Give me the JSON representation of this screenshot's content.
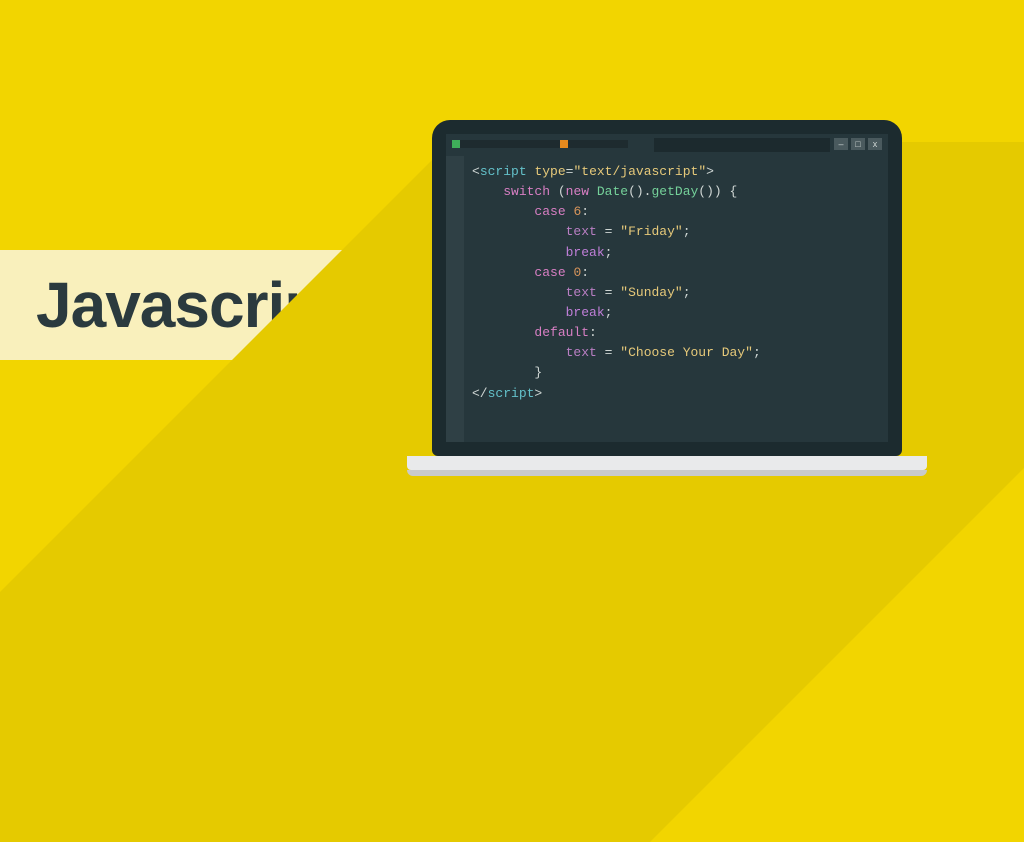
{
  "title": "Javascript",
  "code": {
    "line1": {
      "open_angle": "<",
      "tag": "script",
      "space": " ",
      "attr": "type",
      "eq": "=",
      "q1": "\"",
      "val": "text/javascript",
      "q2": "\"",
      "close_angle": ">"
    },
    "line2": {
      "kw": "switch",
      "sp": " (",
      "new": "new",
      "sp2": " ",
      "cls": "Date",
      "paren": "().",
      "meth": "getDay",
      "tail": "()) {"
    },
    "line3": {
      "kw": "case",
      "sp": " ",
      "num": "6",
      "colon": ":"
    },
    "line4": {
      "var": "text",
      "sp": " ",
      "eq": "=",
      "sp2": " ",
      "q1": "\"",
      "str": "Friday",
      "q2": "\"",
      "semi": ";"
    },
    "line5": {
      "kw": "break",
      "semi": ";"
    },
    "line6": {
      "kw": "case",
      "sp": " ",
      "num": "0",
      "colon": ":"
    },
    "line7": {
      "var": "text",
      "sp": " ",
      "eq": "=",
      "sp2": " ",
      "q1": "\"",
      "str": "Sunday",
      "q2": "\"",
      "semi": ";"
    },
    "line8": {
      "kw": "break",
      "semi": ";"
    },
    "line9": {
      "kw": "default",
      "colon": ":"
    },
    "line10": {
      "var": "text",
      "sp": " ",
      "eq": "=",
      "sp2": " ",
      "q1": "\"",
      "str": "Choose Your Day",
      "q2": "\"",
      "semi": ";"
    },
    "line11": {
      "brace": "}"
    },
    "line12": {
      "open": "</",
      "tag": "script",
      "close": ">"
    }
  },
  "win": {
    "min": "–",
    "max": "□",
    "close": "x"
  }
}
